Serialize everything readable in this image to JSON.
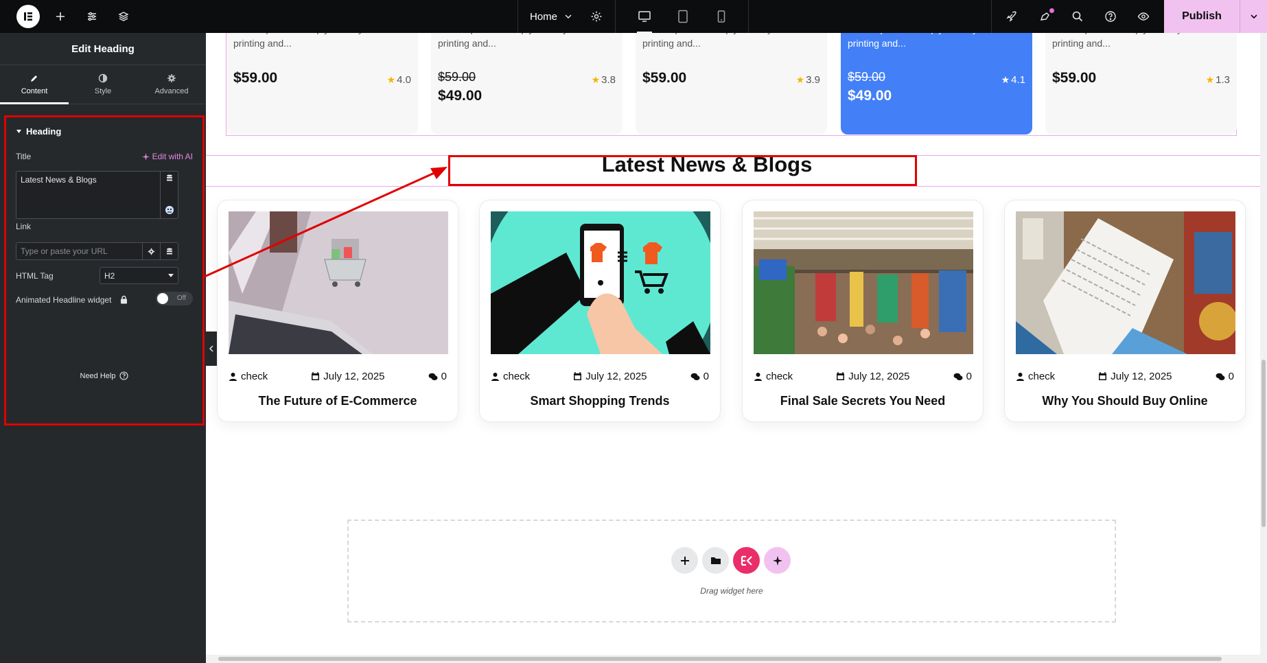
{
  "topbar": {
    "page_name": "Home",
    "publish_label": "Publish"
  },
  "sidebar": {
    "title": "Edit Heading",
    "tabs": [
      {
        "label": "Content"
      },
      {
        "label": "Style"
      },
      {
        "label": "Advanced"
      }
    ],
    "section_label": "Heading",
    "title_label": "Title",
    "edit_ai_label": "Edit with AI",
    "title_value": "Latest News & Blogs",
    "link_label": "Link",
    "link_placeholder": "Type or paste your URL",
    "html_tag_label": "HTML Tag",
    "html_tag_value": "H2",
    "animated_label": "Animated Headline widget",
    "toggle_label": "Off",
    "need_help": "Need Help"
  },
  "products": [
    {
      "desc": "Lorem Ipsum is simply dummy text of the printing and...",
      "price": "$59.00",
      "old_price": "",
      "rating": "4.0",
      "highlight": false
    },
    {
      "desc": "Lorem Ipsum is simply dummy text of the printing and...",
      "price": "$49.00",
      "old_price": "$59.00",
      "rating": "3.8",
      "highlight": false
    },
    {
      "desc": "Lorem Ipsum is simply dummy text of the printing and...",
      "price": "$59.00",
      "old_price": "",
      "rating": "3.9",
      "highlight": false
    },
    {
      "desc": "Lorem Ipsum is simply dummy text of the printing and...",
      "price": "$49.00",
      "old_price": "$59.00",
      "rating": "4.1",
      "highlight": true
    },
    {
      "desc": "Lorem Ipsum is simply dummy text of the printing and...",
      "price": "$59.00",
      "old_price": "",
      "rating": "1.3",
      "highlight": false
    }
  ],
  "section_heading": "Latest News & Blogs",
  "posts": [
    {
      "author": "check",
      "date": "July 12, 2025",
      "comments": "0",
      "title": "The Future of E-Commerce"
    },
    {
      "author": "check",
      "date": "July 12, 2025",
      "comments": "0",
      "title": "Smart Shopping Trends"
    },
    {
      "author": "check",
      "date": "July 12, 2025",
      "comments": "0",
      "title": "Final Sale Secrets You Need"
    },
    {
      "author": "check",
      "date": "July 12, 2025",
      "comments": "0",
      "title": "Why You Should Buy Online"
    }
  ],
  "dropzone_text": "Drag widget here",
  "colors": {
    "accent_pink": "#f1c2f0",
    "highlight_blue": "#4380f7",
    "annotation_red": "#e00000",
    "elementor_pink": "#ea2e6a"
  }
}
